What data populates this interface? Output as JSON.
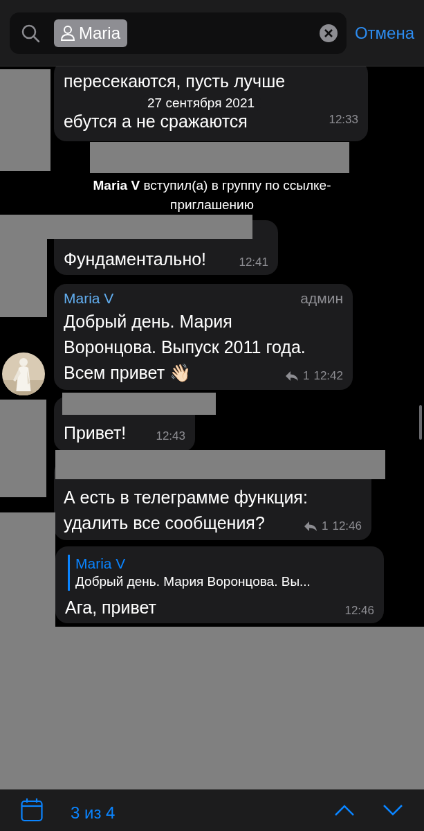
{
  "search": {
    "filter_chip": "Maria",
    "cancel": "Отмена"
  },
  "date_badge": "27 сентября 2021",
  "messages": [
    {
      "kind": "bubble",
      "lines": [
        "пересекаются, пусть лучше",
        "ебутся а не сражаются"
      ],
      "time": "12:33"
    },
    {
      "kind": "service",
      "text": "**Maria V** вступил(а) в группу по ссылке-приглашению"
    },
    {
      "kind": "bubble",
      "text": "Фундаментально!",
      "time": "12:41"
    },
    {
      "kind": "bubble",
      "sender": "Maria V",
      "role": "админ",
      "lines": [
        "Добрый день. Мария",
        "Воронцова. Выпуск 2011 года.",
        "Всем привет 👋🏻"
      ],
      "replies": "1",
      "time": "12:42",
      "avatar": true
    },
    {
      "kind": "bubble",
      "text": "Привет!",
      "time": "12:43"
    },
    {
      "kind": "bubble",
      "lines": [
        "А есть в телеграмме функция:",
        "удалить все сообщения?"
      ],
      "replies": "1",
      "time": "12:46"
    },
    {
      "kind": "bubble",
      "quote": {
        "sender": "Maria V",
        "text": "Добрый день. Мария Воронцова. Вы..."
      },
      "text": "Ага, привет",
      "time": "12:46"
    }
  ],
  "footer": {
    "counter": "3 из 4"
  }
}
